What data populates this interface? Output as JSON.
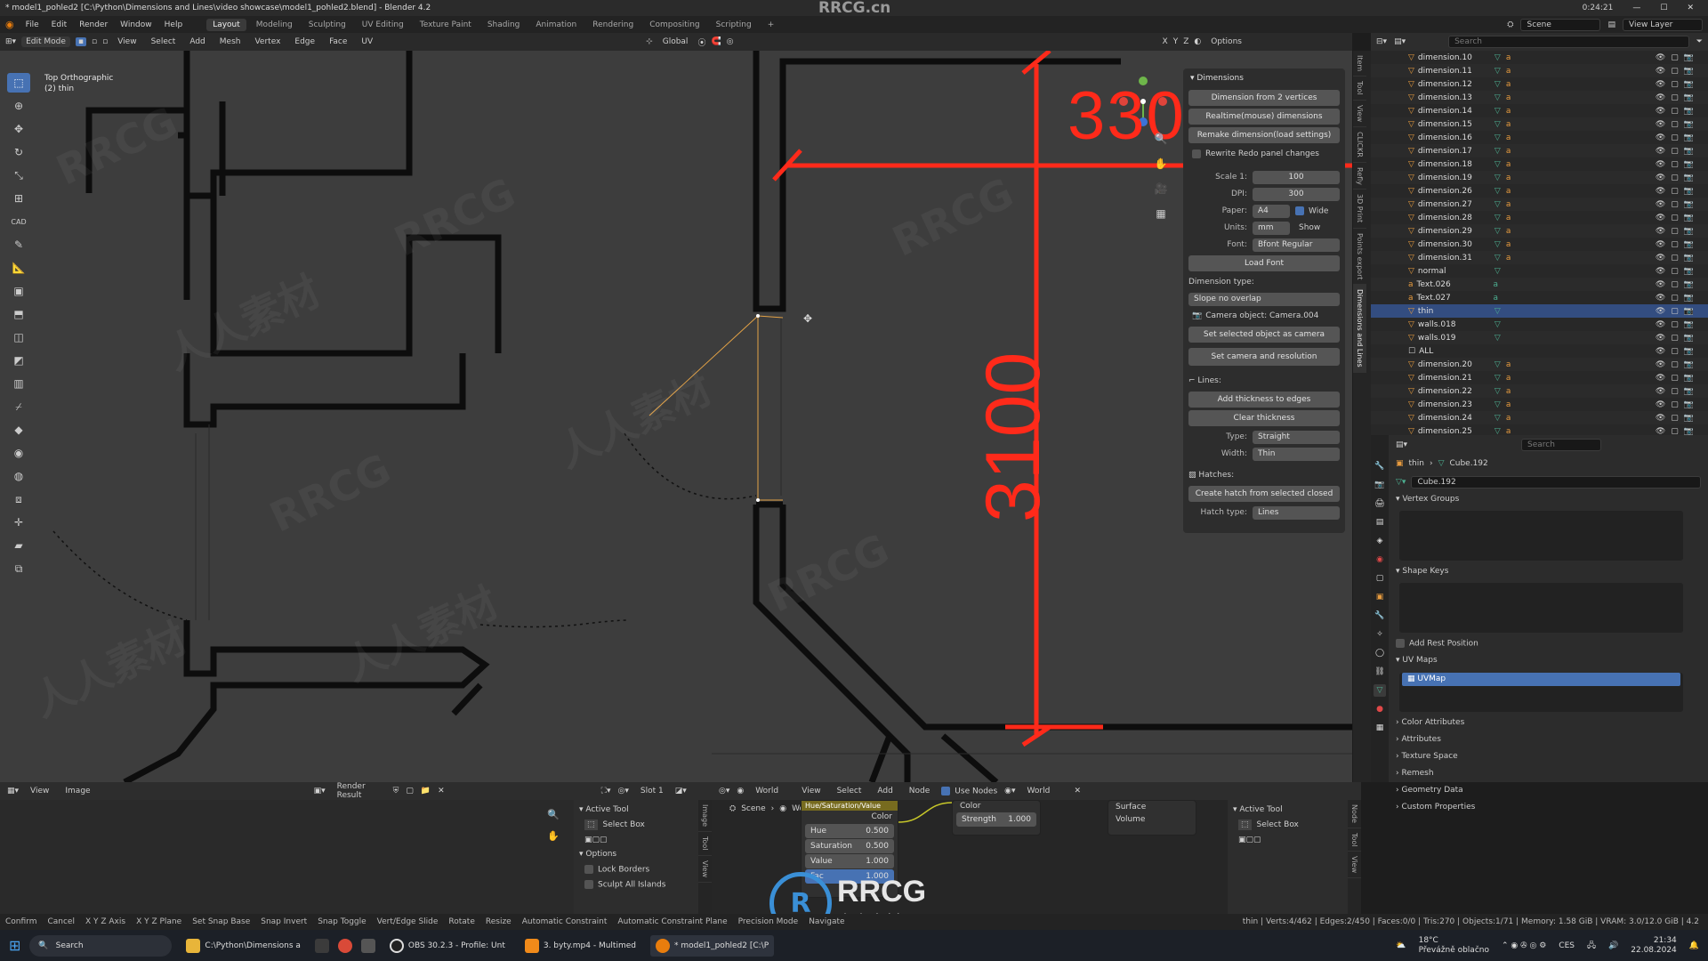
{
  "window": {
    "title": "* model1_pohled2 [C:\\Python\\Dimensions and Lines\\video showcase\\model1_pohled2.blend] - Blender 4.2",
    "watermark_top": "RRCG.cn",
    "time": "0:24:21"
  },
  "menus": [
    "File",
    "Edit",
    "Render",
    "Window",
    "Help"
  ],
  "workspaces": [
    "Layout",
    "Modeling",
    "Sculpting",
    "UV Editing",
    "Texture Paint",
    "Shading",
    "Animation",
    "Rendering",
    "Compositing",
    "Scripting",
    "+"
  ],
  "active_workspace": "Layout",
  "topright": {
    "scene": "Scene",
    "view_layer": "View Layer"
  },
  "viewport_header": {
    "mode": "Edit Mode",
    "items": [
      "View",
      "Select",
      "Add",
      "Mesh",
      "Vertex",
      "Edge",
      "Face",
      "UV"
    ],
    "orientation": "Global",
    "options": "Options",
    "axes": [
      "X",
      "Y",
      "Z"
    ]
  },
  "viewport": {
    "view_name": "Top Orthographic",
    "object_name": "(2) thin",
    "dimension_labels": [
      "330",
      "3100"
    ],
    "dimension_color": "#ff2a1a",
    "watermarks": [
      "RRCG",
      "人人素材"
    ]
  },
  "npanel": {
    "title": "Dimensions",
    "buttons": [
      "Dimension from 2 vertices",
      "Realtime(mouse) dimensions",
      "Remake dimension(load settings)"
    ],
    "rewrite_redo": "Rewrite Redo panel changes",
    "scale_label": "Scale 1:",
    "scale": "100",
    "dpi_label": "DPI:",
    "dpi": "300",
    "paper_label": "Paper:",
    "paper": "A4",
    "wide": "Wide",
    "units_label": "Units:",
    "units": "mm",
    "show": "Show",
    "font_label": "Font:",
    "font": "Bfont Regular",
    "load_font": "Load Font",
    "dimension_type_label": "Dimension type:",
    "dimension_type": "Slope no overlap",
    "camera_object": "Camera object: Camera.004",
    "set_camera": "Set selected object as camera",
    "set_camera_res": "Set camera and resolution",
    "lines_label": "Lines:",
    "add_thickness": "Add thickness to edges",
    "clear_thickness": "Clear thickness",
    "type_label": "Type:",
    "type": "Straight",
    "width_label": "Width:",
    "width": "Thin",
    "hatches_label": "Hatches:",
    "create_hatch": "Create hatch from selected closed area",
    "hatch_type_label": "Hatch type:",
    "hatch_type": "Lines"
  },
  "side_tabs": [
    "Item",
    "Tool",
    "View",
    "CLICKR",
    "Refly",
    "3D Print",
    "Points export",
    "Dimensions and Lines"
  ],
  "outliner": {
    "search_placeholder": "Search",
    "items": [
      {
        "name": "dimension.10",
        "type": "dim"
      },
      {
        "name": "dimension.11",
        "type": "dim"
      },
      {
        "name": "dimension.12",
        "type": "dim"
      },
      {
        "name": "dimension.13",
        "type": "dim"
      },
      {
        "name": "dimension.14",
        "type": "dim"
      },
      {
        "name": "dimension.15",
        "type": "dim"
      },
      {
        "name": "dimension.16",
        "type": "dim"
      },
      {
        "name": "dimension.17",
        "type": "dim"
      },
      {
        "name": "dimension.18",
        "type": "dim"
      },
      {
        "name": "dimension.19",
        "type": "dim"
      },
      {
        "name": "dimension.26",
        "type": "dim"
      },
      {
        "name": "dimension.27",
        "type": "dim"
      },
      {
        "name": "dimension.28",
        "type": "dim"
      },
      {
        "name": "dimension.29",
        "type": "dim"
      },
      {
        "name": "dimension.30",
        "type": "dim"
      },
      {
        "name": "dimension.31",
        "type": "dim"
      },
      {
        "name": "normal",
        "type": "mesh"
      },
      {
        "name": "Text.026",
        "type": "text"
      },
      {
        "name": "Text.027",
        "type": "text"
      },
      {
        "name": "thin",
        "type": "mesh",
        "selected": true
      },
      {
        "name": "walls.018",
        "type": "mesh"
      },
      {
        "name": "walls.019",
        "type": "mesh"
      },
      {
        "name": "ALL",
        "type": "collection"
      },
      {
        "name": "dimension.20",
        "type": "dim"
      },
      {
        "name": "dimension.21",
        "type": "dim"
      },
      {
        "name": "dimension.22",
        "type": "dim"
      },
      {
        "name": "dimension.23",
        "type": "dim"
      },
      {
        "name": "dimension.24",
        "type": "dim"
      },
      {
        "name": "dimension.25",
        "type": "dim"
      }
    ]
  },
  "properties": {
    "search_placeholder": "Search",
    "breadcrumb_object": "thin",
    "breadcrumb_data": "Cube.192",
    "data_name": "Cube.192",
    "sections": {
      "vertex_groups": "Vertex Groups",
      "shape_keys": "Shape Keys",
      "add_rest_position": "Add Rest Position",
      "uv_maps": "UV Maps",
      "uv_map_item": "UVMap",
      "collapsed": [
        "Color Attributes",
        "Attributes",
        "Texture Space",
        "Remesh",
        "Geometry Data",
        "Custom Properties"
      ]
    }
  },
  "image_editor": {
    "menus": [
      "View",
      "Image"
    ],
    "render_result": "Render Result",
    "slot": "Slot 1",
    "active_tool": "Active Tool",
    "select_box": "Select Box",
    "options": "Options",
    "lock_borders": "Lock Borders",
    "sculpt_all_islands": "Sculpt All Islands",
    "tabs": [
      "Image",
      "Tool",
      "View"
    ]
  },
  "node_editor": {
    "world_type": "World",
    "menus": [
      "View",
      "Select",
      "Add",
      "Node"
    ],
    "use_nodes": "Use Nodes",
    "world_name": "World",
    "breadcrumb_scene": "Scene",
    "breadcrumb_world": "World",
    "hsv_node": {
      "title": "Hue/Saturation/Value",
      "color_out": "Color",
      "hue_label": "Hue",
      "hue": "0.500",
      "sat_label": "Saturation",
      "sat": "0.500",
      "val_label": "Value",
      "val": "1.000",
      "fac_label": "Fac",
      "fac": "1.000"
    },
    "bg_node": {
      "color": "Color",
      "strength_label": "Strength",
      "strength": "1.000"
    },
    "output_node": {
      "surface": "Surface",
      "volume": "Volume"
    },
    "active_tool": "Active Tool",
    "select_box": "Select Box",
    "tabs": [
      "Node",
      "Tool",
      "View"
    ]
  },
  "statusbar": {
    "items": [
      "Confirm",
      "Cancel",
      "X Y Z Axis",
      "X Y Z Plane",
      "Set Snap Base",
      "Snap Invert",
      "Snap Toggle",
      "Vert/Edge Slide",
      "Rotate",
      "Resize",
      "Automatic Constraint",
      "Automatic Constraint Plane",
      "Precision Mode",
      "Navigate"
    ],
    "stats": "thin | Verts:4/462 | Edges:2/450 | Faces:0/0 | Tris:270 | Objects:1/71 | Memory: 1.58 GiB | VRAM: 3.0/12.0 GiB | 4.2"
  },
  "taskbar": {
    "search": "Search",
    "apps": [
      "C:\\Python\\Dimensions a",
      "OBS 30.2.3 - Profile: Unt",
      "3. byty.mp4 - Multimed",
      "* model1_pohled2 [C:\\P"
    ],
    "weather_temp": "18°C",
    "weather_text": "Převážně oblačno",
    "lang": "CES",
    "clock": "21:34",
    "date": "22.08.2024"
  },
  "logo": {
    "text": "RRCG",
    "sub": "人人素材"
  }
}
